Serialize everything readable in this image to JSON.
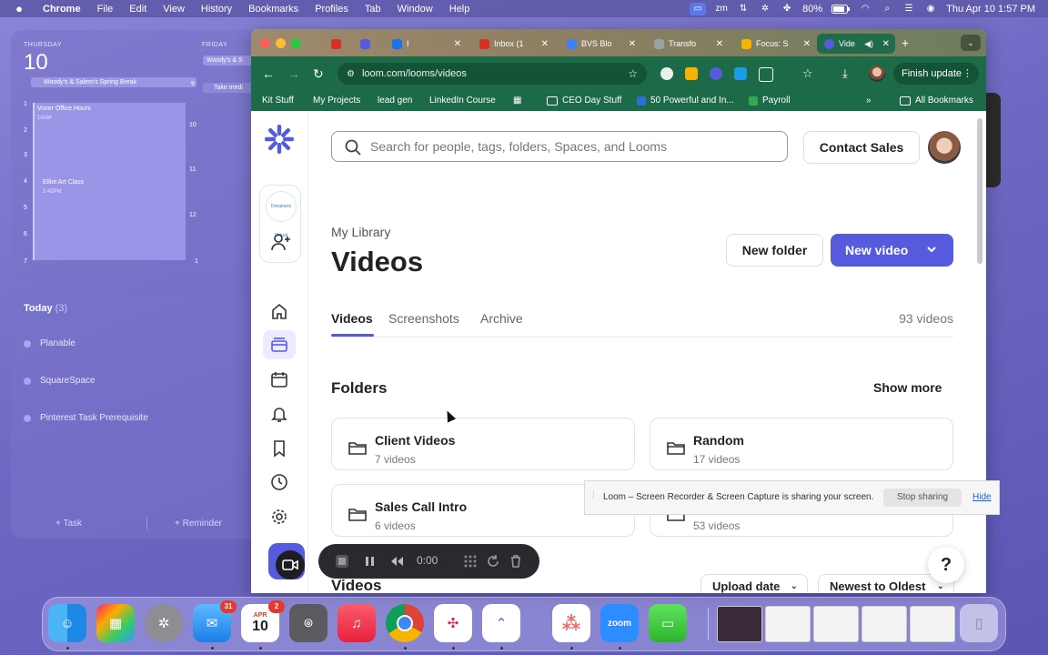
{
  "menubar": {
    "app": "Chrome",
    "items": [
      "File",
      "Edit",
      "View",
      "History",
      "Bookmarks",
      "Profiles",
      "Tab",
      "Window",
      "Help"
    ],
    "battery": "80%",
    "clock": "Thu Apr 10  1:57 PM"
  },
  "calendar": {
    "day1_label": "THURSDAY",
    "day1_num": "10",
    "day2_label": "FRIDAY",
    "banner1": "Woody's & Salem's Spring Break",
    "banner2": "Woody's & S",
    "banner3": "Take medi",
    "hours_left": [
      "1",
      "2",
      "3",
      "4",
      "5",
      "6",
      "7"
    ],
    "hours_right": [
      "9",
      "10",
      "11",
      "12",
      "1"
    ],
    "event1_title": "Voxer Office Hours",
    "event1_time": "10AM",
    "event2_title": "Elliot Art Class",
    "event2_time": "3:45PM"
  },
  "reminders": {
    "today_label": "Today",
    "today_count": "(3)",
    "items": [
      "Planable",
      "SquareSpace",
      "Pinterest Task Prerequisite"
    ],
    "add_task": "+ Task",
    "add_reminder": "+ Reminder"
  },
  "browser": {
    "tabs": [
      {
        "label": "I",
        "color": "#1a73e8"
      },
      {
        "label": "Inbox (1",
        "color": "#d93025"
      },
      {
        "label": "BVS Blo",
        "color": "#3b82f6"
      },
      {
        "label": "Transfo",
        "color": "#9aa0a6"
      },
      {
        "label": "Focus: S",
        "color": "#f4b400"
      },
      {
        "label": "Vide",
        "color": "#565add"
      }
    ],
    "url": "loom.com/looms/videos",
    "finish_update": "Finish update",
    "bookmarks": [
      "Kit Stuff",
      "My Projects",
      "lead gen",
      "LinkedIn Course",
      "CEO Day Stuff",
      "50 Powerful and In...",
      "Payroll",
      "All Bookmarks"
    ]
  },
  "loom": {
    "search_placeholder": "Search for people, tags, folders, Spaces, and Looms",
    "contact_sales": "Contact Sales",
    "library_label": "My Library",
    "page_title": "Videos",
    "new_folder": "New folder",
    "new_video": "New video",
    "tabs": [
      "Videos",
      "Screenshots",
      "Archive"
    ],
    "video_count": "93 videos",
    "folders_heading": "Folders",
    "show_more": "Show more",
    "folders": [
      {
        "name": "Client Videos",
        "count": "7 videos"
      },
      {
        "name": "Random",
        "count": "17 videos"
      },
      {
        "name": "Sales Call Intro",
        "count": "6 videos"
      },
      {
        "name": "",
        "count": "53 videos"
      }
    ],
    "videos_heading": "Videos",
    "sort_upload": "Upload date",
    "sort_order": "Newest to Oldest",
    "workspace_avatar_text": "Dreamers Virtual",
    "help": "?"
  },
  "recorder": {
    "timer": "0:00"
  },
  "share_notice": {
    "message": "Loom – Screen Recorder & Screen Capture is sharing your screen.",
    "stop": "Stop sharing",
    "hide": "Hide"
  },
  "dock": {
    "mail_badge": "31",
    "calendar_month": "APR",
    "calendar_day": "10",
    "calendar_badge": "2",
    "zoom_label": "zoom"
  }
}
